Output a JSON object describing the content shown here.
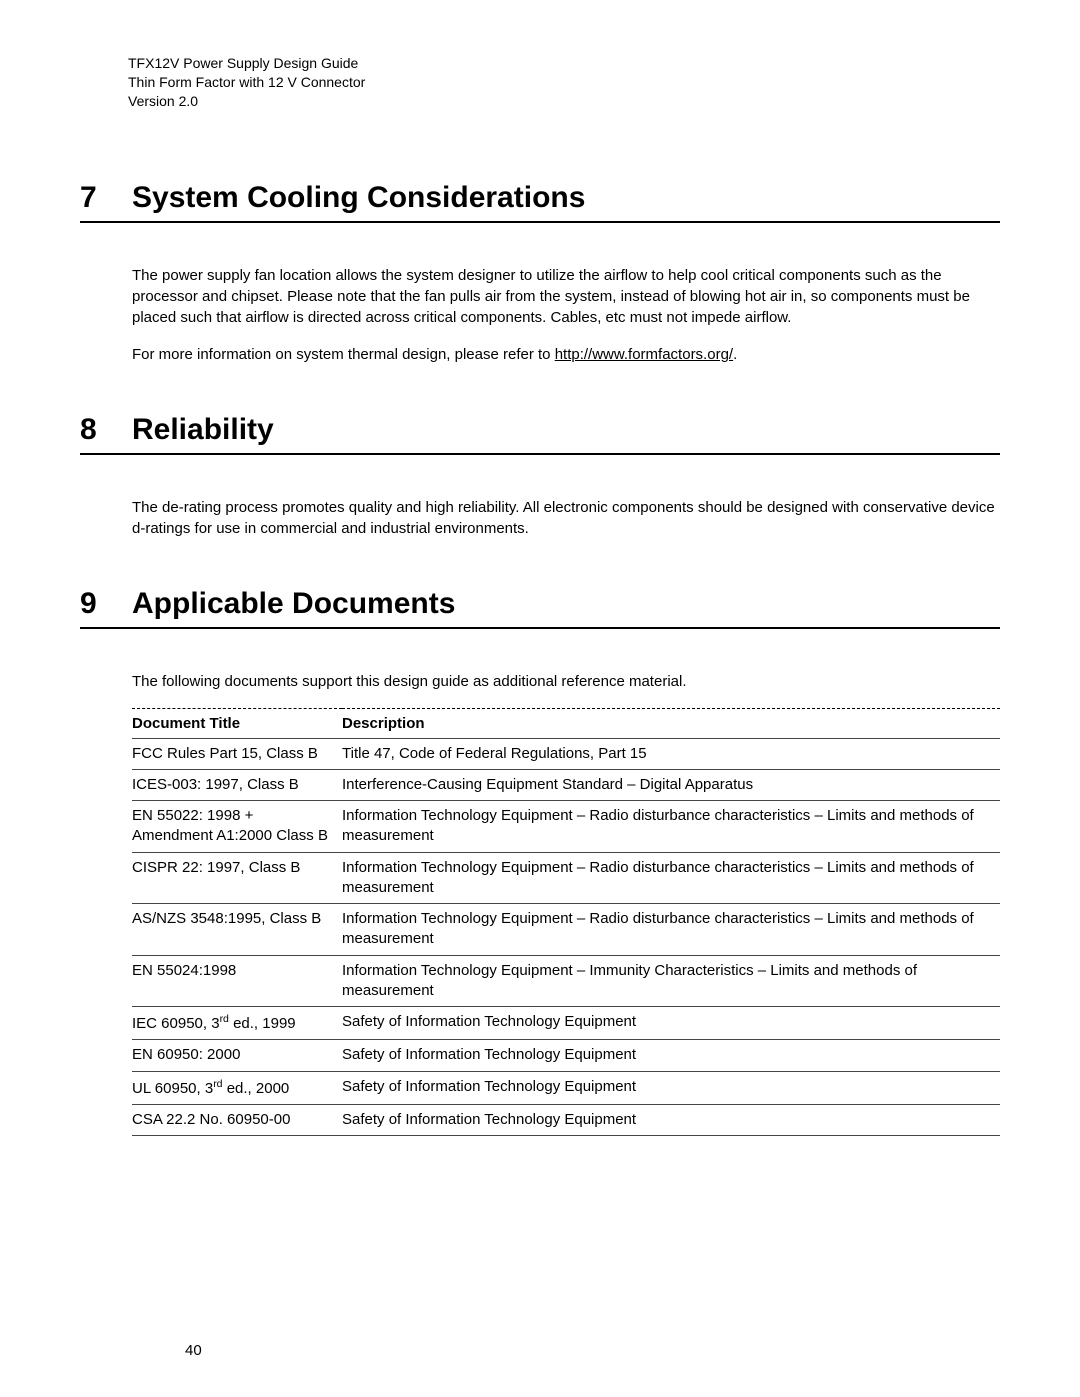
{
  "header": {
    "line1": "TFX12V Power Supply Design Guide",
    "line2": "Thin Form Factor with 12 V Connector",
    "line3": "Version 2.0"
  },
  "sections": {
    "s7": {
      "number": "7",
      "title": "System Cooling Considerations",
      "para1": "The power supply fan location allows the system designer to utilize the airflow to help cool critical components such as the processor and chipset.  Please note that the fan pulls air from the system, instead of blowing hot air in, so components must be placed such that airflow is directed across critical components.  Cables, etc must not impede airflow.",
      "para2_prefix": "For more information on system thermal design, please refer to ",
      "para2_link": "http://www.formfactors.org/",
      "para2_suffix": "."
    },
    "s8": {
      "number": "8",
      "title": "Reliability",
      "para1": "The de-rating process promotes quality and high reliability.  All electronic components should be designed with conservative device d-ratings for use in commercial and industrial environments."
    },
    "s9": {
      "number": "9",
      "title": "Applicable Documents",
      "para1": "The following documents support this design guide as additional reference material."
    }
  },
  "table": {
    "head_title": "Document Title",
    "head_desc": "Description",
    "rows": [
      {
        "title": "FCC Rules Part 15, Class B",
        "desc": "Title 47, Code of Federal Regulations, Part 15"
      },
      {
        "title": "ICES-003: 1997, Class B",
        "desc": "Interference-Causing Equipment Standard – Digital Apparatus"
      },
      {
        "title": "EN 55022: 1998 + Amendment A1:2000 Class B",
        "desc": "Information Technology Equipment – Radio disturbance characteristics – Limits and methods of measurement"
      },
      {
        "title": "CISPR 22: 1997, Class B",
        "desc": "Information Technology Equipment – Radio disturbance characteristics – Limits and methods of measurement"
      },
      {
        "title": "AS/NZS 3548:1995, Class B",
        "desc": "Information Technology Equipment – Radio disturbance characteristics – Limits and methods of measurement"
      },
      {
        "title": "EN 55024:1998",
        "desc": "Information Technology Equipment – Immunity Characteristics – Limits and methods of measurement"
      },
      {
        "title_html": "IEC 60950, 3<sup class=\"sup\">rd</sup> ed., 1999",
        "desc": "Safety of Information Technology Equipment"
      },
      {
        "title": "EN 60950: 2000",
        "desc": "Safety of Information Technology Equipment"
      },
      {
        "title_html": "UL 60950, 3<sup class=\"sup\">rd</sup> ed., 2000",
        "desc": "Safety of Information Technology Equipment"
      },
      {
        "title": "CSA 22.2 No. 60950-00",
        "desc": "Safety of Information Technology Equipment"
      }
    ]
  },
  "page_number": "40"
}
